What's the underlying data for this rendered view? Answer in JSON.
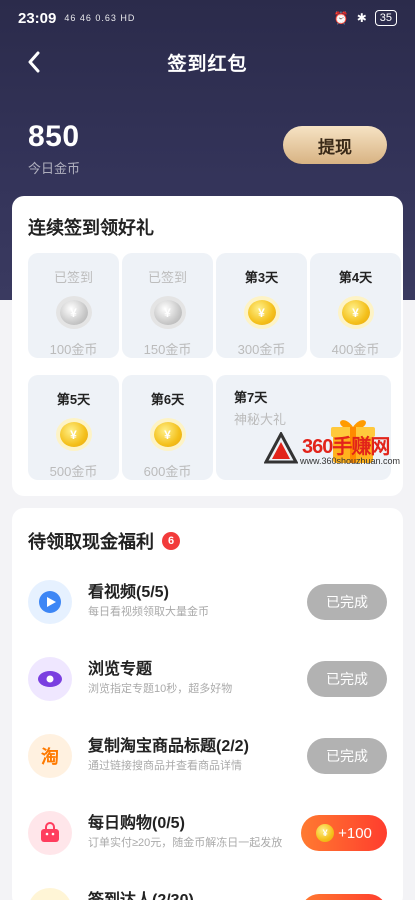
{
  "status_bar": {
    "time": "23:09",
    "network": "46 46 0.63 HD",
    "battery": "35"
  },
  "nav": {
    "title": "签到红包"
  },
  "coins": {
    "value": "850",
    "label": "今日金币"
  },
  "withdraw": {
    "label": "提现"
  },
  "signin": {
    "title": "连续签到领好礼",
    "days": [
      {
        "label": "已签到",
        "reward": "100金币",
        "signed": true
      },
      {
        "label": "已签到",
        "reward": "150金币",
        "signed": true
      },
      {
        "label": "第3天",
        "reward": "300金币",
        "signed": false
      },
      {
        "label": "第4天",
        "reward": "400金币",
        "signed": false
      },
      {
        "label": "第5天",
        "reward": "500金币",
        "signed": false
      },
      {
        "label": "第6天",
        "reward": "600金币",
        "signed": false
      }
    ],
    "day7": {
      "label": "第7天",
      "reward": "神秘大礼"
    },
    "coin_symbol": "¥"
  },
  "watermark": {
    "text": "360手赚网",
    "url": "www.360shouzhuan.com"
  },
  "tasks": {
    "title": "待领取现金福利",
    "badge": "6",
    "items": [
      {
        "name": "看视频(5/5)",
        "desc": "每日看视频领取大量金币",
        "button": "已完成",
        "icon": "play-icon"
      },
      {
        "name": "浏览专题",
        "desc": "浏览指定专题10秒，超多好物",
        "button": "已完成",
        "icon": "eye-icon"
      },
      {
        "name": "复制淘宝商品标题(2/2)",
        "desc": "通过链接搜商品并查看商品详情",
        "button": "已完成",
        "icon": "taobao-icon",
        "icon_text": "淘"
      },
      {
        "name": "每日购物(0/5)",
        "desc": "订单实付≥20元，随金币解冻日一起发放",
        "button": "+100",
        "icon": "bag-icon"
      },
      {
        "name": "签到达人(2/30)",
        "desc": "",
        "button": "",
        "icon": "star-icon"
      }
    ]
  },
  "colors": {
    "header": "#2b2b4b",
    "accent": "#ff5a2e",
    "gold": "#f4c01b"
  }
}
